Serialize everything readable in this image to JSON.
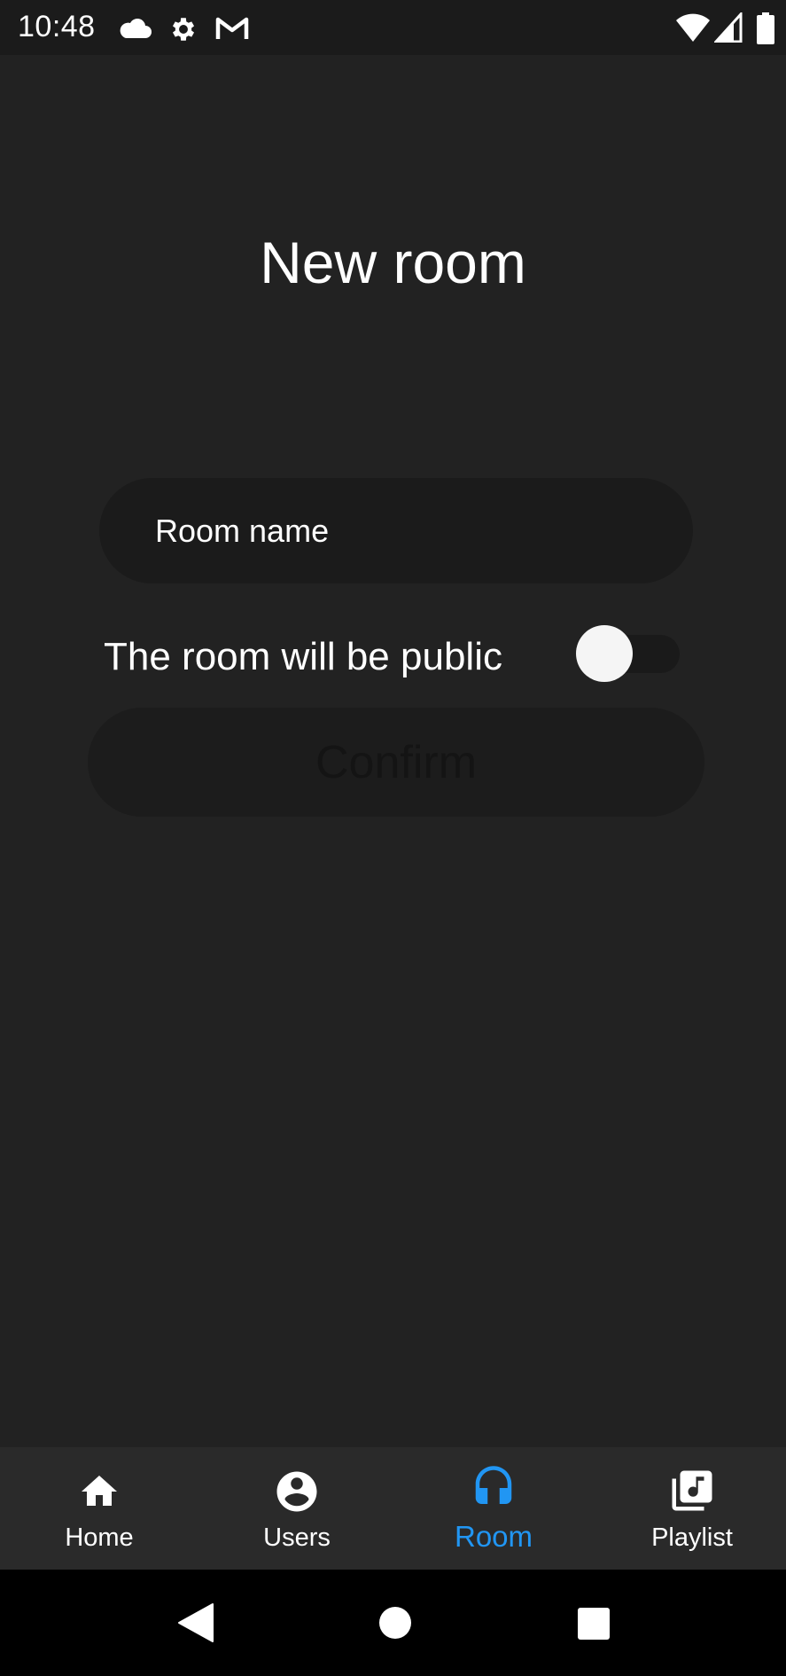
{
  "status_bar": {
    "time": "10:48",
    "left_icons": [
      "cloud-icon",
      "gear-icon",
      "gmail-icon"
    ],
    "right_icons": [
      "wifi-icon",
      "cell-signal-icon",
      "battery-icon"
    ]
  },
  "page": {
    "title": "New room"
  },
  "form": {
    "room_name_placeholder": "Room name",
    "public_label": "The room will be public",
    "public_toggle_on": false,
    "confirm_label": "Confirm"
  },
  "bottom_nav": {
    "items": [
      {
        "label": "Home",
        "icon": "home-icon",
        "active": false
      },
      {
        "label": "Users",
        "icon": "account-circle-icon",
        "active": false
      },
      {
        "label": "Room",
        "icon": "headphones-icon",
        "active": true
      },
      {
        "label": "Playlist",
        "icon": "library-music-icon",
        "active": false
      }
    ]
  },
  "colors": {
    "background": "#222222",
    "accent": "#2196f3",
    "nav_background": "#2a2a2a",
    "field_background": "#1b1b1b"
  },
  "system_nav": {
    "buttons": [
      "back-icon",
      "home-circle-icon",
      "recents-icon"
    ]
  }
}
